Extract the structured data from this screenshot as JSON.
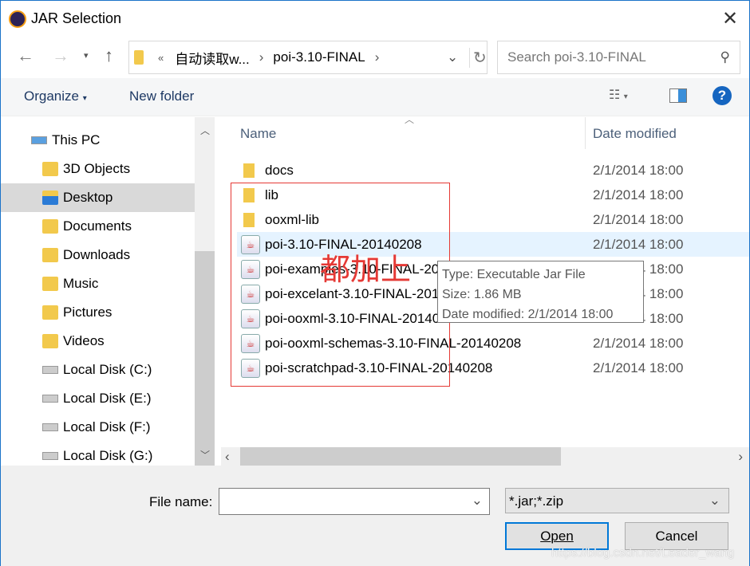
{
  "window": {
    "title": "JAR Selection",
    "icon": "eclipse-icon"
  },
  "address": {
    "crumbs": [
      "«",
      "自动读取w...",
      "poi-3.10-FINAL"
    ],
    "search_placeholder": "Search poi-3.10-FINAL"
  },
  "toolbar": {
    "organize": "Organize",
    "new_folder": "New folder"
  },
  "sidebar": {
    "items": [
      {
        "label": "This PC",
        "icon": "pc-icon"
      },
      {
        "label": "3D Objects",
        "icon": "folder-icon"
      },
      {
        "label": "Desktop",
        "icon": "desktop-icon",
        "selected": true
      },
      {
        "label": "Documents",
        "icon": "folder-icon"
      },
      {
        "label": "Downloads",
        "icon": "folder-icon"
      },
      {
        "label": "Music",
        "icon": "folder-icon"
      },
      {
        "label": "Pictures",
        "icon": "folder-icon"
      },
      {
        "label": "Videos",
        "icon": "folder-icon"
      },
      {
        "label": "Local Disk (C:)",
        "icon": "disk-icon"
      },
      {
        "label": "Local Disk (E:)",
        "icon": "disk-icon"
      },
      {
        "label": "Local Disk (F:)",
        "icon": "disk-icon"
      },
      {
        "label": "Local Disk (G:)",
        "icon": "disk-icon"
      }
    ]
  },
  "columns": {
    "name": "Name",
    "date": "Date modified"
  },
  "files": [
    {
      "name": "docs",
      "date": "2/1/2014 18:00",
      "type": "folder"
    },
    {
      "name": "lib",
      "date": "2/1/2014 18:00",
      "type": "folder"
    },
    {
      "name": "ooxml-lib",
      "date": "2/1/2014 18:00",
      "type": "folder"
    },
    {
      "name": "poi-3.10-FINAL-20140208",
      "date": "2/1/2014 18:00",
      "type": "jar",
      "selected": true
    },
    {
      "name": "poi-examples-3.10-FINAL-20140208",
      "date": "2/1/2014 18:00",
      "type": "jar"
    },
    {
      "name": "poi-excelant-3.10-FINAL-20140208",
      "date": "2/1/2014 18:00",
      "type": "jar"
    },
    {
      "name": "poi-ooxml-3.10-FINAL-20140208",
      "date": "2/1/2014 18:00",
      "type": "jar"
    },
    {
      "name": "poi-ooxml-schemas-3.10-FINAL-20140208",
      "date": "2/1/2014 18:00",
      "type": "jar"
    },
    {
      "name": "poi-scratchpad-3.10-FINAL-20140208",
      "date": "2/1/2014 18:00",
      "type": "jar"
    }
  ],
  "tooltip": {
    "type": "Type: Executable Jar File",
    "size": "Size: 1.86 MB",
    "date": "Date modified: 2/1/2014 18:00"
  },
  "annotation": {
    "text": "都加上",
    "color": "#e53935"
  },
  "footer": {
    "file_name_label": "File name:",
    "file_name_value": "",
    "filter": "*.jar;*.zip",
    "open": "Open",
    "cancel": "Cancel"
  },
  "watermark": "https://blog.csdn.net/Leader_wang"
}
